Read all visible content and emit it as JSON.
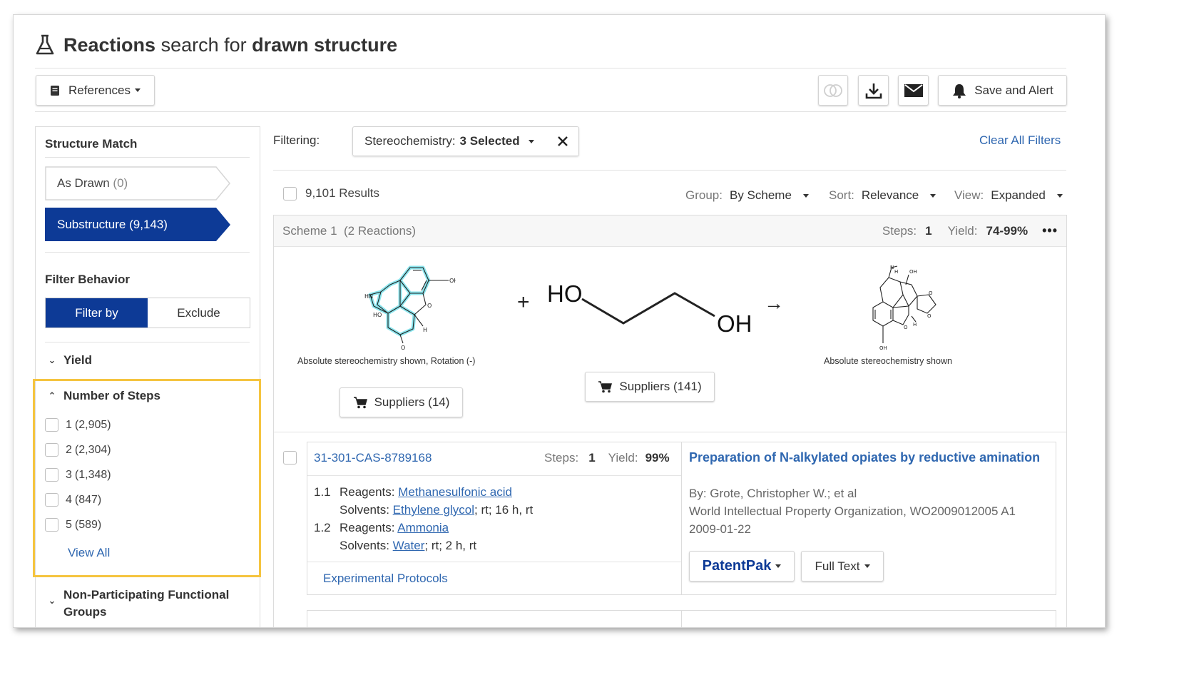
{
  "header": {
    "title_prefix": "Reactions",
    "title_middle": "search for",
    "title_suffix": "drawn structure"
  },
  "toolbar": {
    "references_label": "References",
    "save_alert_label": "Save and Alert"
  },
  "sidebar": {
    "structure_match_title": "Structure Match",
    "as_drawn": {
      "label": "As Drawn",
      "count": "(0)"
    },
    "substructure_label": "Substructure (9,143)",
    "filter_behavior_title": "Filter Behavior",
    "filter_by_label": "Filter by",
    "exclude_label": "Exclude",
    "yield_label": "Yield",
    "steps_title": "Number of Steps",
    "steps": [
      {
        "n": "1",
        "count": "(2,905)"
      },
      {
        "n": "2",
        "count": "(2,304)"
      },
      {
        "n": "3",
        "count": "(1,348)"
      },
      {
        "n": "4",
        "count": "(847)"
      },
      {
        "n": "5",
        "count": "(589)"
      }
    ],
    "view_all_label": "View All",
    "npfg_label_line1": "Non-Participating Functional",
    "npfg_label_line2": "Groups"
  },
  "filters": {
    "filtering_label": "Filtering:",
    "chip_label": "Stereochemistry:",
    "chip_value": "3 Selected",
    "clear_all_label": "Clear All Filters"
  },
  "results": {
    "count_label": "9,101 Results",
    "group_label": "Group:",
    "group_value": "By Scheme",
    "sort_label": "Sort:",
    "sort_value": "Relevance",
    "view_label": "View:",
    "view_value": "Expanded"
  },
  "scheme": {
    "title": "Scheme 1",
    "reactions": "(2 Reactions)",
    "steps_label": "Steps:",
    "steps_value": "1",
    "yield_label": "Yield:",
    "yield_value": "74-99%",
    "more_label": "•••",
    "reactant1_caption": "Absolute stereochemistry shown, Rotation (-)",
    "product_caption": "Absolute stereochemistry shown",
    "suppliers1_label": "Suppliers (14)",
    "suppliers2_label": "Suppliers (141)",
    "plus": "+",
    "arrow": "→",
    "ho_label": "HO",
    "oh_label": "OH"
  },
  "reaction": {
    "id": "31-301-CAS-8789168",
    "steps_label": "Steps:",
    "steps_value": "1",
    "yield_label": "Yield:",
    "yield_value": "99%",
    "step1_num": "1.1",
    "step1_reagents_label": "Reagents:",
    "step1_reagent": "Methanesulfonic acid",
    "step1_solvents_label": "Solvents:",
    "step1_solvent": "Ethylene glycol",
    "step1_cond": "; rt; 16 h, rt",
    "step2_num": "1.2",
    "step2_reagents_label": "Reagents:",
    "step2_reagent": "Ammonia",
    "step2_solvents_label": "Solvents:",
    "step2_solvent": "Water",
    "step2_cond": "; rt; 2 h, rt",
    "protocols_label": "Experimental Protocols",
    "ref_title": "Preparation of N-alkylated opiates by reductive amination",
    "ref_authors": "By: Grote, Christopher W.; et al",
    "ref_source": "World Intellectual Property Organization, WO2009012005 A1",
    "ref_date": "2009-01-22",
    "patentpak_label": "PatentPak",
    "fulltext_label": "Full Text"
  }
}
